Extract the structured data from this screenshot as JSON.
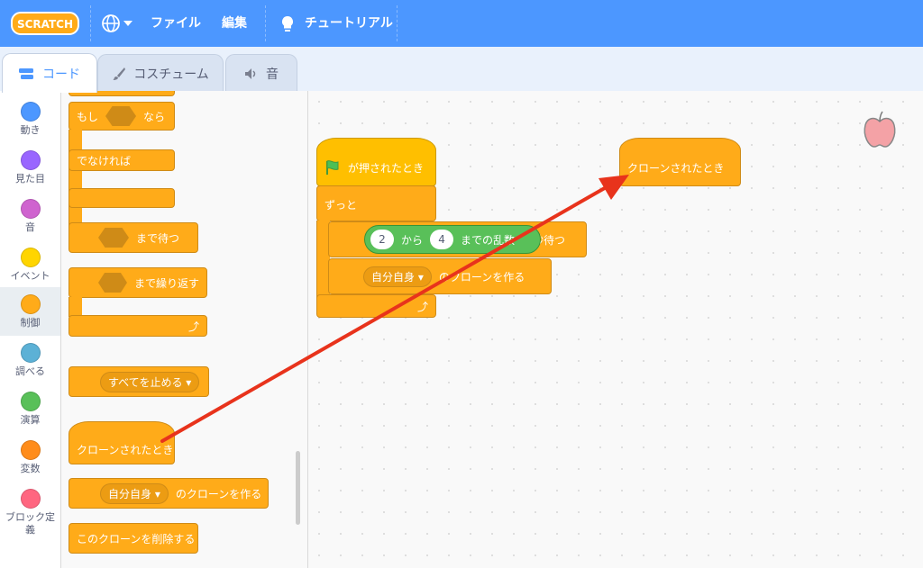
{
  "menubar": {
    "logo_text": "SCRATCH",
    "file": "ファイル",
    "edit": "編集",
    "tutorials": "チュートリアル"
  },
  "tabs": {
    "code": "コード",
    "costumes": "コスチューム",
    "sounds": "音"
  },
  "categories": [
    {
      "label": "動き",
      "color": "#4c97ff"
    },
    {
      "label": "見た目",
      "color": "#9966ff"
    },
    {
      "label": "音",
      "color": "#cf63cf"
    },
    {
      "label": "イベント",
      "color": "#ffd500"
    },
    {
      "label": "制御",
      "color": "#ffab19"
    },
    {
      "label": "調べる",
      "color": "#5cb1d6"
    },
    {
      "label": "演算",
      "color": "#59c059"
    },
    {
      "label": "変数",
      "color": "#ff8c1a"
    },
    {
      "label": "ブロック定",
      "label2": "義",
      "color": "#ff6680"
    }
  ],
  "palette": {
    "if_then_prefix": "もし",
    "if_then_suffix": "なら",
    "else": "でなければ",
    "wait_until": "まで待つ",
    "repeat_until": "まで繰り返す",
    "stop_all": "すべてを止める",
    "when_clone": "クローンされたとき",
    "create_clone_target": "自分自身",
    "create_clone_suffix": "のクローンを作る",
    "delete_clone": "このクローンを削除する"
  },
  "script": {
    "green_flag_hat": "が押されたとき",
    "forever": "ずっと",
    "rand_from": "2",
    "rand_mid": "から",
    "rand_to": "4",
    "rand_suffix": "までの乱数",
    "wait_suffix": "秒待つ",
    "clone_target": "自分自身",
    "clone_suffix": "のクローンを作る",
    "clone_hat": "クローンされたとき"
  },
  "colors": {
    "control": "#ffab19",
    "events": "#ffbf00",
    "operators": "#59c059",
    "menubar": "#4c97ff",
    "arrow": "#e8331c"
  }
}
